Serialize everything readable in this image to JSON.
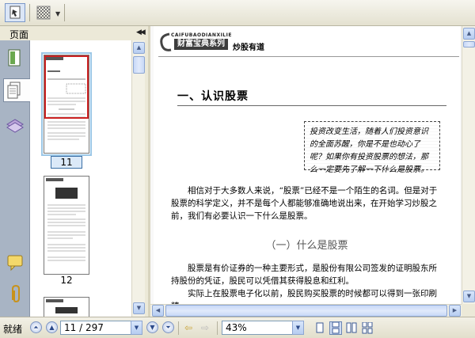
{
  "toolbar": {
    "buttons": [
      {
        "name": "select-tool",
        "icon": "arrow-page-icon"
      },
      {
        "name": "pattern-tool",
        "icon": "checker-icon"
      }
    ]
  },
  "panel": {
    "title": "页面",
    "thumbnails": [
      {
        "label": "11",
        "selected": true
      },
      {
        "label": "12",
        "selected": false
      }
    ]
  },
  "document": {
    "logo_text": "CAIFUBAODIANXILIE",
    "logo_box": "财富宝典系列",
    "header_subtitle": "炒股有道",
    "chapter_title": "一、认识股票",
    "quote": "投资改变生活，随着人们投资意识的全面苏醒，你是不是也动心了呢？如果你有投资股票的想法，那么一定要先了解一下什么是股票。",
    "paragraph1": "相信对于大多数人来说，“股票”已经不是一个陌生的名词。但是对于股票的科学定义，并不是每个人都能够准确地说出来，在开始学习炒股之前，我们有必要认识一下什么是股票。",
    "section_heading": "（一）什么是股票",
    "paragraph2": "股票是有价证券的一种主要形式，是股份有限公司签发的证明股东所持股份的凭证，股民可以凭借其获得股息和红利。",
    "paragraph3": "实际上在股票电子化以前，股民购买股票的时候都可以得到一张印刷精"
  },
  "statusbar": {
    "status": "就绪",
    "page_display": "11 / 297",
    "zoom": "43%"
  },
  "colors": {
    "sidebar_blue": "#a8b4c4",
    "selection_red": "#cc2222",
    "scrollbar_blue": "#b7cdf1"
  }
}
